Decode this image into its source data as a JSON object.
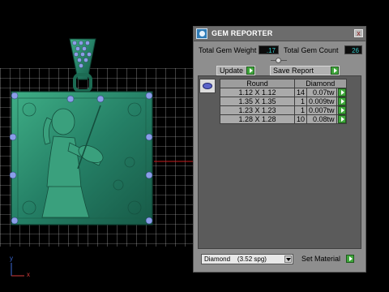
{
  "panel": {
    "title": "GEM REPORTER",
    "close_label": "x",
    "total_weight_label": "Total Gem Weight",
    "total_weight_value": ".17",
    "total_count_label": "Total Gem Count",
    "total_count_value": "26",
    "update_label": "Update",
    "save_report_label": "Save Report",
    "table": {
      "headers": [
        "Round",
        "Diamond"
      ],
      "rows": [
        {
          "size": "1.12 X 1.12",
          "count": "14",
          "weight": "0.07tw"
        },
        {
          "size": "1.35 X 1.35",
          "count": "1",
          "weight": "0.009tw"
        },
        {
          "size": "1.23 X 1.23",
          "count": "1",
          "weight": "0.007tw"
        },
        {
          "size": "1.28 X 1.28",
          "count": "10",
          "weight": "0.08tw"
        }
      ]
    },
    "material_value": "Diamond    (3.52 spg)",
    "set_material_label": "Set Material"
  },
  "viewport": {
    "axis_x_label": "x",
    "axis_y_label": "y"
  },
  "colors": {
    "pendant": "#2c8a6a",
    "gem": "#8a9ee8",
    "grid": "#d8d8d8",
    "accent_go": "#3fa63b"
  }
}
